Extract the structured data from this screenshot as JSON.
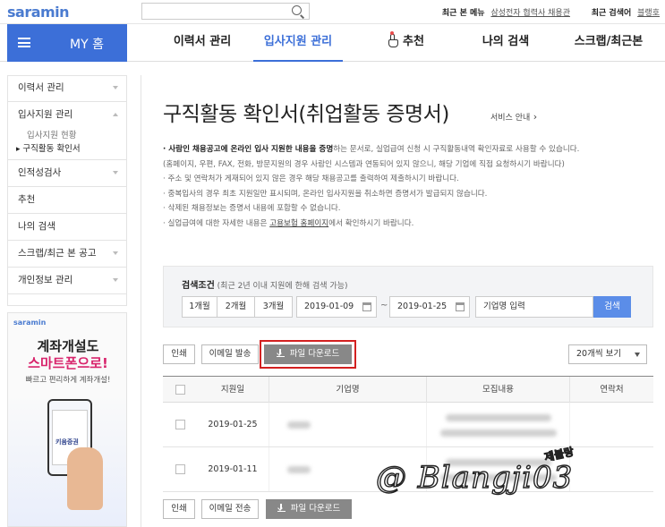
{
  "header": {
    "logo": "saramin",
    "search_placeholder": "",
    "recent_menu_label": "최근 본 메뉴",
    "recent_menu_value": "삼성전자 협력사 채용관",
    "recent_search_label": "최근 검색어",
    "recent_search_value": "블랭호"
  },
  "nav": {
    "my_home": "MY 홈",
    "tabs": [
      {
        "label": "이력서 관리"
      },
      {
        "label": "입사지원 관리"
      },
      {
        "label": "추천"
      },
      {
        "label": "나의 검색"
      },
      {
        "label": "스크랩/최근본"
      }
    ]
  },
  "sidebar": {
    "items": [
      {
        "label": "이력서 관리"
      },
      {
        "label": "입사지원 관리"
      },
      {
        "label": "인적성검사"
      },
      {
        "label": "추천"
      },
      {
        "label": "나의 검색"
      },
      {
        "label": "스크랩/최근 본 공고"
      },
      {
        "label": "개인정보 관리"
      }
    ],
    "sub_items": [
      {
        "label": "입사지원 현황"
      },
      {
        "label": "구직활동 확인서"
      }
    ]
  },
  "ad": {
    "logo": "saramin",
    "headline1": "계좌개설도",
    "headline2": "스마트폰으로!",
    "subline": "빠르고 편리하게 계좌개설!",
    "phone_text": "키움증권"
  },
  "main": {
    "title": "구직활동 확인서(취업활동 증명서)",
    "service_link": "서비스 안내",
    "info": {
      "line1_bold": "· 사람인 채용공고에 온라인 입사 지원한 내용을 증명",
      "line1_rest": "하는 문서로, 실업급여 신청 시 구직활동내역 확인자료로 사용할 수 있습니다.",
      "line2": "(홈페이지, 우편, FAX, 전화, 방문지원의 경우 사람인 시스템과 연동되어 있지 않으니, 해당 기업에 직접 요청하시기 바랍니다)",
      "line3": "· 주소 및 연락처가 게재되어 있지 않은 경우 해당 채용공고를 출력하여 제출하시기 바랍니다.",
      "line4": "· 중복입사의 경우 최초 지원일만 표시되며, 온라인 입사지원을 취소하면 증명서가 발급되지 않습니다.",
      "line5": "· 삭제된 채용정보는 증명서 내용에 포함할 수 없습니다.",
      "line6_pre": "· 실업급여에 대한 자세한 내용은 ",
      "line6_link": "고용보험 홈페이지",
      "line6_post": "에서 확인하시기 바랍니다."
    }
  },
  "search_panel": {
    "label": "검색조건",
    "label_note": " (최근 2년 이내 지원에 한해 검색 가능)",
    "btn_1m": "1개월",
    "btn_2m": "2개월",
    "btn_3m": "3개월",
    "date_from": "2019-01-09",
    "date_to": "2019-01-25",
    "tilde": "~",
    "company_input": "기업명 입력",
    "search_btn": "검색"
  },
  "toolbar": {
    "print": "인쇄",
    "email": "이메일 발송",
    "download": "파일 다운로드",
    "per_page": "20개씩 보기",
    "email_bottom": "이메일 전송"
  },
  "table": {
    "headers": [
      "지원일",
      "기업명",
      "모집내용",
      "연락처"
    ],
    "rows": [
      {
        "date": "2019-01-25"
      },
      {
        "date": "2019-01-11"
      }
    ]
  },
  "watermark": {
    "main": "@ Blangji03",
    "small": "제블랑"
  },
  "colors": {
    "accent": "#3c6fd8",
    "search_button": "#5b8de8",
    "highlight": "#d32020"
  }
}
